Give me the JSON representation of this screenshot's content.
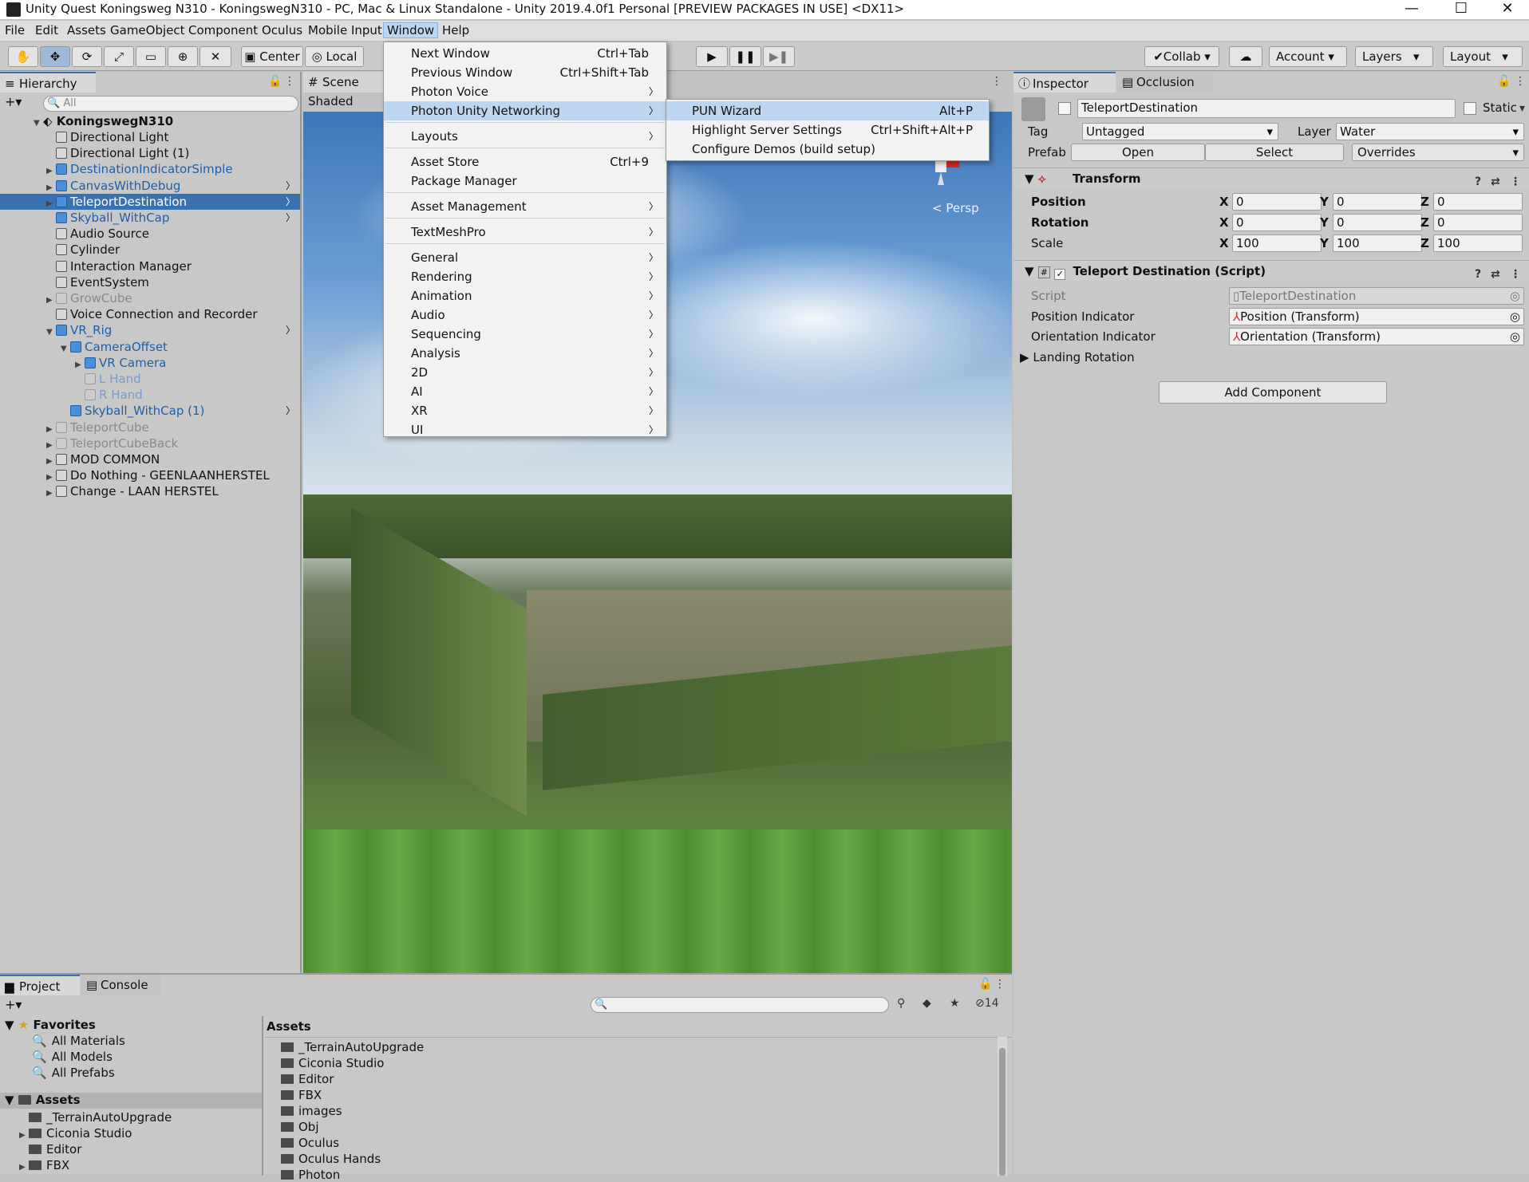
{
  "window": {
    "title": "Unity Quest Koningsweg N310 - KoningswegN310 - PC, Mac & Linux Standalone - Unity 2019.4.0f1 Personal [PREVIEW PACKAGES IN USE] <DX11>"
  },
  "menubar": [
    "File",
    "Edit",
    "Assets",
    "GameObject",
    "Component",
    "Oculus",
    "Mobile Input",
    "Window",
    "Help"
  ],
  "toolbar": {
    "center": "Center",
    "local": "Local",
    "collab": "Collab",
    "account": "Account",
    "layers": "Layers",
    "layout": "Layout"
  },
  "hierarchy": {
    "tab": "Hierarchy",
    "search_placeholder": "All",
    "scene": "KoningswegN310",
    "items": [
      {
        "label": "Directional Light"
      },
      {
        "label": "Directional Light (1)"
      },
      {
        "label": "DestinationIndicatorSimple"
      },
      {
        "label": "CanvasWithDebug"
      },
      {
        "label": "TeleportDestination"
      },
      {
        "label": "Skyball_WithCap"
      },
      {
        "label": "Audio Source"
      },
      {
        "label": "Cylinder"
      },
      {
        "label": "Interaction Manager"
      },
      {
        "label": "EventSystem"
      },
      {
        "label": "GrowCube"
      },
      {
        "label": "Voice Connection and Recorder"
      },
      {
        "label": "VR_Rig"
      },
      {
        "label": "CameraOffset"
      },
      {
        "label": "VR Camera"
      },
      {
        "label": "L Hand"
      },
      {
        "label": "R Hand"
      },
      {
        "label": "Skyball_WithCap (1)"
      },
      {
        "label": "TeleportCube"
      },
      {
        "label": "TeleportCubeBack"
      },
      {
        "label": "MOD COMMON"
      },
      {
        "label": "Do Nothing - GEENLAANHERSTEL"
      },
      {
        "label": "Change - LAAN HERSTEL"
      }
    ]
  },
  "scene": {
    "tab": "Scene",
    "shading": "Shaded",
    "persp": "Persp"
  },
  "window_menu": {
    "items": [
      {
        "label": "Next Window",
        "shortcut": "Ctrl+Tab"
      },
      {
        "label": "Previous Window",
        "shortcut": "Ctrl+Shift+Tab"
      },
      {
        "label": "Photon Voice",
        "shortcut": ""
      },
      {
        "label": "Photon Unity Networking",
        "shortcut": ""
      },
      {
        "label": "Layouts",
        "shortcut": ""
      },
      {
        "label": "Asset Store",
        "shortcut": "Ctrl+9"
      },
      {
        "label": "Package Manager",
        "shortcut": ""
      },
      {
        "label": "Asset Management",
        "shortcut": ""
      },
      {
        "label": "TextMeshPro",
        "shortcut": ""
      },
      {
        "label": "General",
        "shortcut": ""
      },
      {
        "label": "Rendering",
        "shortcut": ""
      },
      {
        "label": "Animation",
        "shortcut": ""
      },
      {
        "label": "Audio",
        "shortcut": ""
      },
      {
        "label": "Sequencing",
        "shortcut": ""
      },
      {
        "label": "Analysis",
        "shortcut": ""
      },
      {
        "label": "2D",
        "shortcut": ""
      },
      {
        "label": "AI",
        "shortcut": ""
      },
      {
        "label": "XR",
        "shortcut": ""
      },
      {
        "label": "UI",
        "shortcut": ""
      }
    ],
    "submenu": [
      {
        "label": "PUN Wizard",
        "shortcut": "Alt+P"
      },
      {
        "label": "Highlight Server Settings",
        "shortcut": "Ctrl+Shift+Alt+P"
      },
      {
        "label": "Configure Demos (build setup)",
        "shortcut": ""
      }
    ]
  },
  "inspector": {
    "tab": "Inspector",
    "tab2": "Occlusion",
    "object_name": "TeleportDestination",
    "static": "Static",
    "tag_label": "Tag",
    "tag": "Untagged",
    "layer_label": "Layer",
    "layer": "Water",
    "prefab_label": "Prefab",
    "open": "Open",
    "select": "Select",
    "overrides": "Overrides",
    "transform": {
      "title": "Transform",
      "position": "Position",
      "rotation": "Rotation",
      "scale": "Scale",
      "pos": [
        "0",
        "0",
        "0"
      ],
      "rot": [
        "0",
        "0",
        "0"
      ],
      "scl": [
        "100",
        "100",
        "100"
      ]
    },
    "script_comp": {
      "title": "Teleport Destination (Script)",
      "script_label": "Script",
      "script": "TeleportDestination",
      "pos_label": "Position Indicator",
      "pos": "Position (Transform)",
      "ori_label": "Orientation Indicator",
      "ori": "Orientation (Transform)",
      "landing": "Landing Rotation"
    },
    "add_component": "Add Component"
  },
  "project": {
    "tab": "Project",
    "tab2": "Console",
    "hidden_count": "14",
    "favorites": "Favorites",
    "fav_items": [
      "All Materials",
      "All Models",
      "All Prefabs"
    ],
    "assets": "Assets",
    "tree_items": [
      "_TerrainAutoUpgrade",
      "Ciconia Studio",
      "Editor",
      "FBX"
    ],
    "assets_header": "Assets",
    "asset_items": [
      "_TerrainAutoUpgrade",
      "Ciconia Studio",
      "Editor",
      "FBX",
      "images",
      "Obj",
      "Oculus",
      "Oculus Hands",
      "Photon"
    ]
  }
}
